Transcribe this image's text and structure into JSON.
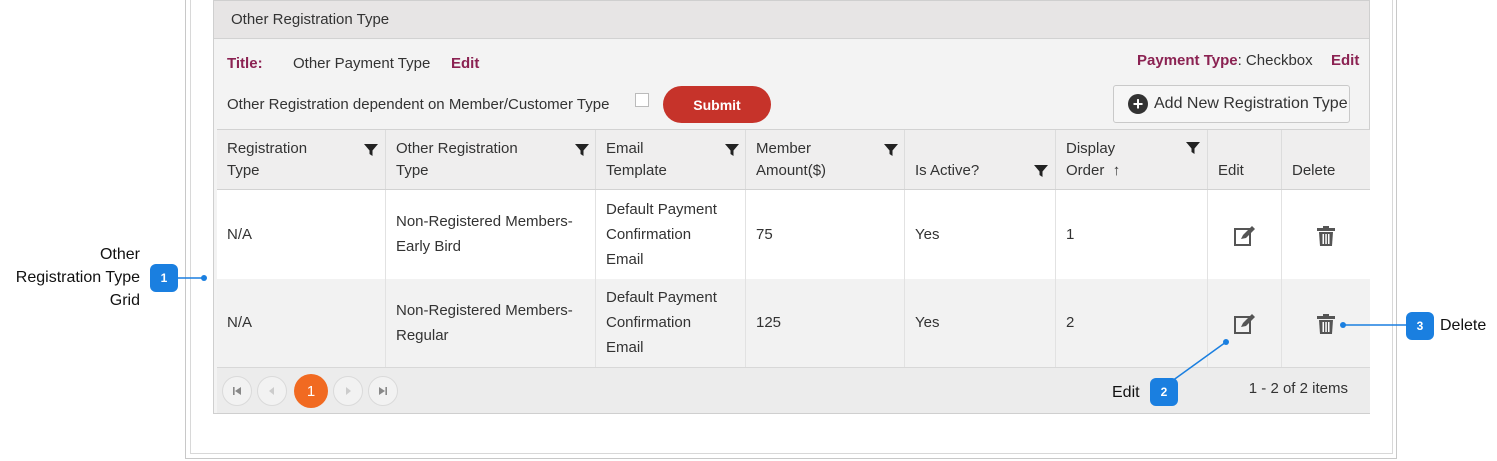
{
  "panel": {
    "header": "Other Registration Type"
  },
  "settings": {
    "title_label": "Title:",
    "title_value": "Other Payment Type",
    "title_edit": "Edit",
    "payment_type_label": "Payment Type",
    "payment_type_value": ": Checkbox",
    "payment_type_edit": "Edit",
    "dependent_label": "Other Registration dependent on Member/Customer Type",
    "dependent_checked": false,
    "submit_label": "Submit",
    "add_new_label": "Add New Registration Type"
  },
  "grid": {
    "columns": [
      {
        "line1": "Registration",
        "line2": "Type"
      },
      {
        "line1": "Other Registration",
        "line2": "Type"
      },
      {
        "line1": "Email",
        "line2": "Template"
      },
      {
        "line1": "Member",
        "line2": "Amount($)"
      },
      {
        "line1": "",
        "line2": "Is Active?"
      },
      {
        "line1": "Display",
        "line2": "Order"
      },
      {
        "line1": "",
        "line2": "Edit"
      },
      {
        "line1": "",
        "line2": "Delete"
      }
    ],
    "sort_indicator": "↑",
    "rows": [
      {
        "registration_type": "N/A",
        "other_registration_type": [
          "Non-Registered Members-",
          "Early Bird"
        ],
        "email_template": [
          "Default Payment",
          "Confirmation",
          "Email"
        ],
        "member_amount": "75",
        "is_active": "Yes",
        "display_order": "1"
      },
      {
        "registration_type": "N/A",
        "other_registration_type": [
          "Non-Registered Members-",
          "Regular"
        ],
        "email_template": [
          "Default Payment",
          "Confirmation",
          "Email"
        ],
        "member_amount": "125",
        "is_active": "Yes",
        "display_order": "2"
      }
    ]
  },
  "pager": {
    "current_page": "1",
    "items_info": "1 - 2 of 2 items"
  },
  "callouts": {
    "grid": {
      "number": "1",
      "lines": [
        "Other",
        "Registration Type",
        "Grid"
      ]
    },
    "edit": {
      "number": "2",
      "label": "Edit"
    },
    "delete": {
      "number": "3",
      "label": "Delete"
    }
  },
  "colors": {
    "accent_maroon": "#8b2252",
    "submit_red": "#c6332a",
    "pager_orange": "#f16a21",
    "callout_blue": "#1a7fe0"
  }
}
